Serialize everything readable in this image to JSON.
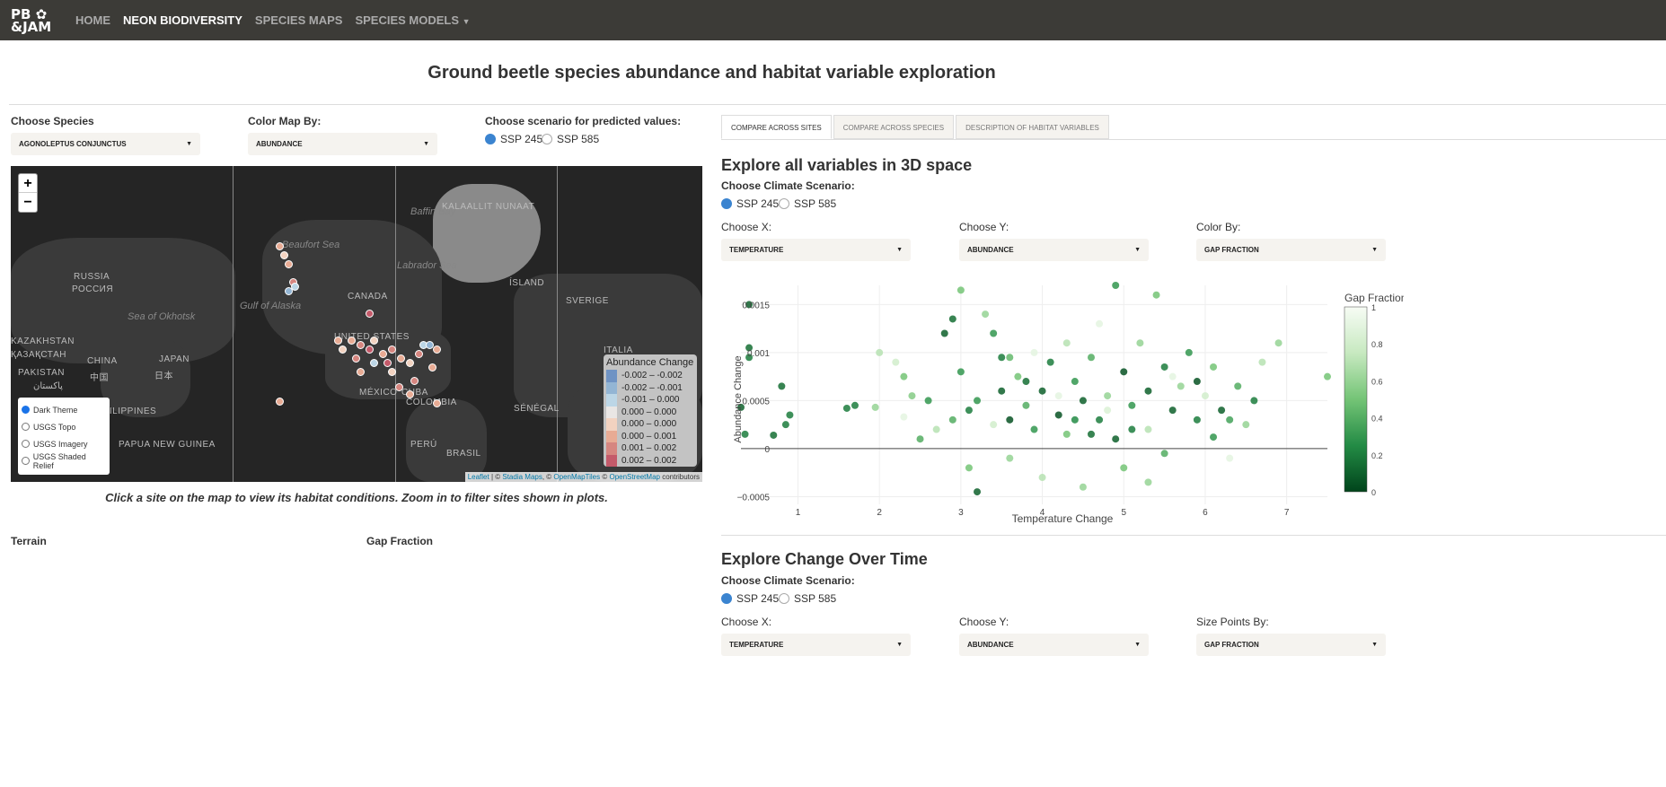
{
  "nav": {
    "logo": "PB & JAM",
    "items": [
      "HOME",
      "NEON BIODIVERSITY",
      "SPECIES MAPS",
      "SPECIES MODELS"
    ],
    "active": 1
  },
  "title": "Ground beetle species abundance and habitat variable exploration",
  "left": {
    "species_label": "Choose Species",
    "species_value": "AGONOLEPTUS CONJUNCTUS",
    "color_label": "Color Map By:",
    "color_value": "ABUNDANCE",
    "scenario_label": "Choose scenario for predicted values:",
    "scenario_options": [
      "SSP 245",
      "SSP 585"
    ],
    "scenario_selected": "SSP 245",
    "map": {
      "zoom_in": "+",
      "zoom_out": "−",
      "labels": [
        "KALAALLIT NUNAAT",
        "Beaufort Sea",
        "Baffin Bay",
        "ÍSLAND",
        "Gulf of Alaska",
        "CANADA",
        "Labrador Sea",
        "SVERIGE",
        "RUSSIA",
        "РОССИЯ",
        "Sea of Okhotsk",
        "KAZAKHSTAN",
        "ҚАЗАҚСТАН",
        "JAPAN",
        "日本",
        "CHINA",
        "中国",
        "PAKISTAN",
        "پاکستان",
        "UNITED STATES",
        "MÉXICO",
        "CUBA",
        "ITALIA",
        "SÉNÉGAL",
        "COLOMBIA",
        "PERÚ",
        "BRASIL",
        "PHILIPPINES",
        "PAPUA NEW GUINEA"
      ],
      "basemaps": [
        "Dark Theme",
        "USGS Topo",
        "USGS Imagery",
        "USGS Shaded Relief"
      ],
      "basemap_selected": "Dark Theme",
      "legend_title": "Abundance Change",
      "legend": [
        {
          "label": "-0.002 – -0.002",
          "color": "#6f93c4"
        },
        {
          "label": "-0.002 – -0.001",
          "color": "#93b5d4"
        },
        {
          "label": "-0.001 – 0.000",
          "color": "#bcd6e6"
        },
        {
          "label": "0.000 – 0.000",
          "color": "#e9e6e4"
        },
        {
          "label": "0.000 – 0.000",
          "color": "#f2d2c0"
        },
        {
          "label": "0.000 – 0.001",
          "color": "#e8ab94"
        },
        {
          "label": "0.001 – 0.002",
          "color": "#d68680"
        },
        {
          "label": "0.002 – 0.002",
          "color": "#c45a6a"
        }
      ],
      "attribution": {
        "leaflet": "Leaflet",
        "sep": " | © ",
        "stadia": "Stadia Maps",
        "c1": ", © ",
        "omt": "OpenMapTiles",
        "c2": " © ",
        "osm": "OpenStreetMap",
        "tail": " contributors"
      }
    },
    "caption": "Click a site on the map to view its habitat conditions. Zoom in to filter sites shown in plots.",
    "terrain_label": "Terrain",
    "gap_label": "Gap Fraction"
  },
  "right": {
    "tabs": [
      "COMPARE ACROSS SITES",
      "COMPARE ACROSS SPECIES",
      "DESCRIPTION OF HABITAT VARIABLES"
    ],
    "active_tab": 0,
    "section1": {
      "title": "Explore all variables in 3D space",
      "scenario_label": "Choose Climate Scenario:",
      "options": [
        "SSP 245",
        "SSP 585"
      ],
      "selected": "SSP 245",
      "x_label": "Choose X:",
      "x_value": "TEMPERATURE",
      "y_label": "Choose Y:",
      "y_value": "ABUNDANCE",
      "c_label": "Color By:",
      "c_value": "GAP FRACTION"
    },
    "section2": {
      "title": "Explore Change Over Time",
      "scenario_label": "Choose Climate Scenario:",
      "options": [
        "SSP 245",
        "SSP 585"
      ],
      "selected": "SSP 245",
      "x_label": "Choose X:",
      "x_value": "TEMPERATURE",
      "y_label": "Choose Y:",
      "y_value": "ABUNDANCE",
      "s_label": "Size Points By:",
      "s_value": "GAP FRACTION"
    }
  },
  "chart_data": {
    "type": "scatter",
    "xlabel": "Temperature Change",
    "ylabel": "Abundance Change",
    "colorbar_title": "Gap Fraction",
    "xlim": [
      0.3,
      7.5
    ],
    "ylim": [
      -0.00058,
      0.0017
    ],
    "xticks": [
      1,
      2,
      3,
      4,
      5,
      6,
      7
    ],
    "yticks": [
      -0.0005,
      0,
      0.0005,
      0.001,
      0.0015
    ],
    "ytick_labels": [
      "−0.0005",
      "0",
      "0.0005",
      "0.001",
      "0.0015"
    ],
    "colorbar_ticks": [
      0,
      0.2,
      0.4,
      0.6,
      0.8,
      1
    ],
    "colorscale": [
      "#00441b",
      "#238b45",
      "#74c476",
      "#c7e9c0",
      "#f7fcf5"
    ],
    "grid": true,
    "points": [
      [
        0.4,
        0.0015,
        0.1
      ],
      [
        0.4,
        0.00105,
        0.15
      ],
      [
        0.4,
        0.00095,
        0.2
      ],
      [
        0.8,
        0.00065,
        0.15
      ],
      [
        0.9,
        0.00035,
        0.2
      ],
      [
        0.85,
        0.00025,
        0.2
      ],
      [
        0.7,
        0.00014,
        0.15
      ],
      [
        0.3,
        0.00043,
        0.1
      ],
      [
        0.35,
        0.00015,
        0.2
      ],
      [
        1.6,
        0.00042,
        0.2
      ],
      [
        1.7,
        0.00045,
        0.2
      ],
      [
        1.95,
        0.00043,
        0.6
      ],
      [
        2.0,
        0.001,
        0.7
      ],
      [
        2.2,
        0.0009,
        0.8
      ],
      [
        2.3,
        0.00075,
        0.5
      ],
      [
        2.3,
        0.00033,
        0.9
      ],
      [
        2.5,
        0.0001,
        0.4
      ],
      [
        2.6,
        0.0005,
        0.3
      ],
      [
        2.7,
        0.0002,
        0.7
      ],
      [
        2.8,
        0.0012,
        0.1
      ],
      [
        2.9,
        0.00135,
        0.15
      ],
      [
        3.0,
        0.00165,
        0.5
      ],
      [
        3.0,
        0.0008,
        0.3
      ],
      [
        3.1,
        0.0004,
        0.2
      ],
      [
        3.1,
        -0.0002,
        0.5
      ],
      [
        3.2,
        -0.00045,
        0.1
      ],
      [
        3.3,
        0.0014,
        0.6
      ],
      [
        3.4,
        0.0012,
        0.3
      ],
      [
        3.5,
        0.00095,
        0.2
      ],
      [
        3.5,
        0.0006,
        0.1
      ],
      [
        3.6,
        0.0003,
        0.05
      ],
      [
        3.6,
        -0.0001,
        0.6
      ],
      [
        3.7,
        0.00075,
        0.5
      ],
      [
        3.8,
        0.00045,
        0.4
      ],
      [
        3.9,
        0.001,
        0.9
      ],
      [
        3.9,
        0.0002,
        0.3
      ],
      [
        4.0,
        0.0006,
        0.1
      ],
      [
        4.0,
        -0.0003,
        0.7
      ],
      [
        4.1,
        0.0009,
        0.2
      ],
      [
        4.2,
        0.00035,
        0.05
      ],
      [
        4.3,
        0.0011,
        0.7
      ],
      [
        4.3,
        0.00015,
        0.5
      ],
      [
        4.4,
        0.0007,
        0.3
      ],
      [
        4.5,
        0.0005,
        0.1
      ],
      [
        4.5,
        -0.0004,
        0.6
      ],
      [
        4.6,
        0.00095,
        0.4
      ],
      [
        4.7,
        0.0013,
        0.9
      ],
      [
        4.7,
        0.0003,
        0.2
      ],
      [
        4.8,
        0.00055,
        0.6
      ],
      [
        4.9,
        0.0017,
        0.3
      ],
      [
        4.9,
        0.0001,
        0.1
      ],
      [
        5.0,
        0.0008,
        0.05
      ],
      [
        5.0,
        -0.0002,
        0.5
      ],
      [
        5.1,
        0.00045,
        0.3
      ],
      [
        5.2,
        0.0011,
        0.6
      ],
      [
        5.3,
        0.0006,
        0.1
      ],
      [
        5.3,
        0.0002,
        0.7
      ],
      [
        5.4,
        0.0016,
        0.5
      ],
      [
        5.5,
        0.00085,
        0.2
      ],
      [
        5.5,
        -5e-05,
        0.4
      ],
      [
        5.6,
        0.0004,
        0.1
      ],
      [
        5.7,
        0.00065,
        0.6
      ],
      [
        5.8,
        0.001,
        0.3
      ],
      [
        5.9,
        0.0003,
        0.2
      ],
      [
        6.0,
        0.00055,
        0.8
      ],
      [
        6.1,
        0.00085,
        0.5
      ],
      [
        6.1,
        0.00012,
        0.3
      ],
      [
        6.2,
        0.0004,
        0.1
      ],
      [
        6.3,
        -0.0001,
        0.9
      ],
      [
        6.4,
        0.00065,
        0.4
      ],
      [
        6.5,
        0.00025,
        0.6
      ],
      [
        6.6,
        0.0005,
        0.2
      ],
      [
        6.7,
        0.0009,
        0.7
      ],
      [
        6.9,
        0.0011,
        0.6
      ],
      [
        7.5,
        0.00075,
        0.5
      ],
      [
        3.4,
        0.00025,
        0.8
      ],
      [
        4.2,
        0.00055,
        0.9
      ],
      [
        4.8,
        0.0004,
        0.85
      ],
      [
        5.6,
        0.00075,
        0.9
      ],
      [
        3.2,
        0.0005,
        0.3
      ],
      [
        2.9,
        0.0003,
        0.4
      ],
      [
        4.6,
        0.00015,
        0.15
      ],
      [
        5.1,
        0.0002,
        0.2
      ],
      [
        5.9,
        0.0007,
        0.05
      ],
      [
        3.8,
        0.0007,
        0.15
      ],
      [
        4.4,
        0.0003,
        0.25
      ],
      [
        6.3,
        0.0003,
        0.35
      ],
      [
        2.4,
        0.00055,
        0.55
      ],
      [
        3.6,
        0.00095,
        0.45
      ],
      [
        5.3,
        -0.00035,
        0.6
      ]
    ]
  }
}
